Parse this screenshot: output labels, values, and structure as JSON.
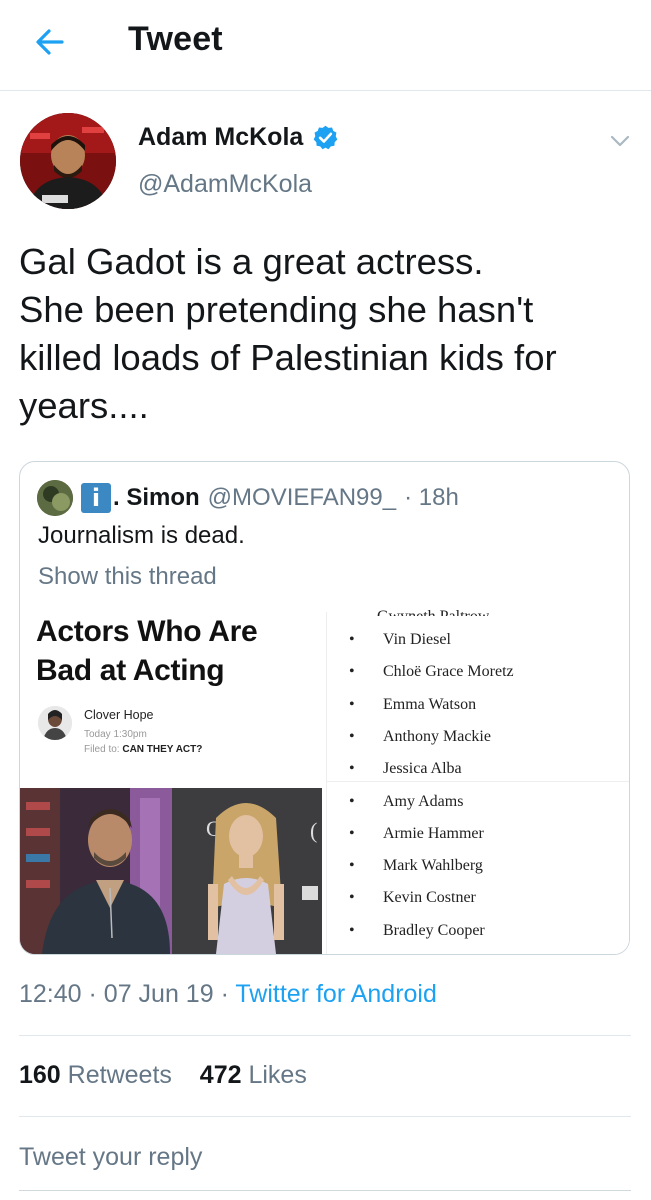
{
  "header": {
    "title": "Tweet"
  },
  "tweet": {
    "name": "Adam McKola",
    "handle": "@AdamMcKola",
    "text_lines": [
      "Gal Gadot is a great actress.",
      "She been pretending she hasn't",
      "killed loads of Palestinian kids for",
      "years...."
    ]
  },
  "quote": {
    "badge": "i",
    "name": ". Simon",
    "handle": "@MOVIEFAN99_",
    "time": "· 18h",
    "text": "Journalism is dead.",
    "show_thread": "Show this thread",
    "media": {
      "title_line1": "Actors Who Are",
      "title_line2": "Bad at Acting",
      "author": "Clover Hope",
      "date": "Today 1:30pm",
      "filed_label": "Filed to:",
      "filed_tag": "CAN THEY ACT?",
      "list": [
        "Vin Diesel",
        "Chloë Grace Moretz",
        "Emma Watson",
        "Anthony Mackie",
        "Jessica Alba",
        "Amy Adams",
        "Armie Hammer",
        "Mark Wahlberg",
        "Kevin Costner",
        "Bradley Cooper"
      ]
    }
  },
  "meta": {
    "time": "12:40",
    "date": "07 Jun 19",
    "source": "Twitter for Android"
  },
  "stats": {
    "retweets_count": "160",
    "retweets_label": "Retweets",
    "likes_count": "472",
    "likes_label": "Likes"
  },
  "reply": {
    "placeholder": "Tweet your reply"
  },
  "colors": {
    "accent": "#1da1f2",
    "secondary_text": "#657786",
    "divider": "#e1e8ed"
  }
}
